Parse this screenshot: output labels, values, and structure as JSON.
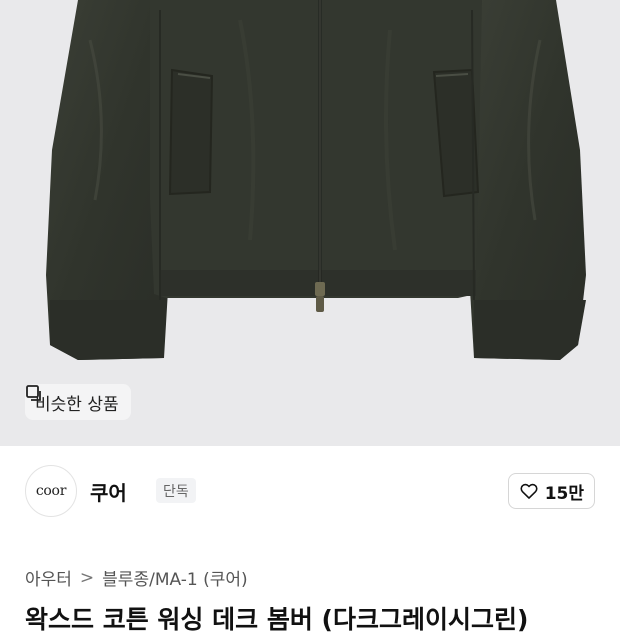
{
  "product": {
    "image_alt": "dark green waxed cotton jacket",
    "similar_button_label": "비슷한 상품",
    "title": "왁스드 코튼 워싱 데크 봄버 (다크그레이시그린)"
  },
  "brand": {
    "logo_text": "coor",
    "name": "쿠어",
    "badge": "단독"
  },
  "like": {
    "count": "15만"
  },
  "breadcrumb": {
    "items": [
      "아우터",
      "블루종/MA-1 (쿠어)"
    ],
    "separator": ">"
  },
  "colors": {
    "background": "#e9e9eb",
    "jacket": "#33372f"
  }
}
